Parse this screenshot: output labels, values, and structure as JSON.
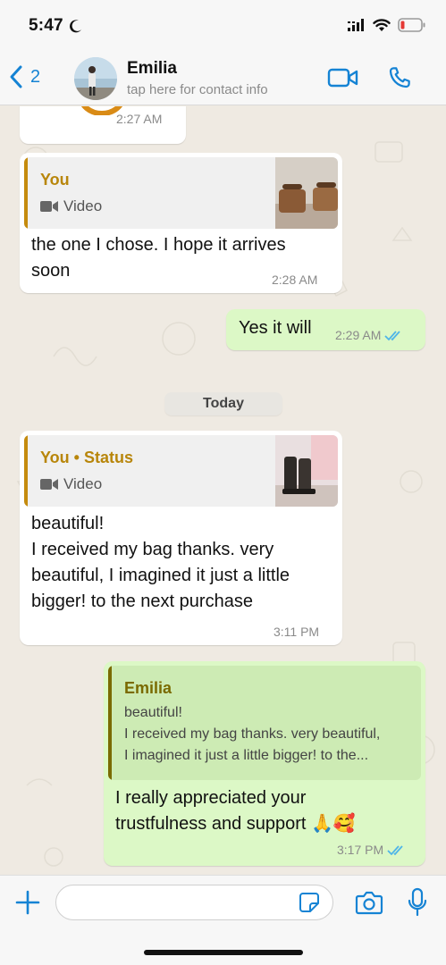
{
  "status_bar": {
    "time": "5:47"
  },
  "header": {
    "back_count": "2",
    "contact_name": "Emilia",
    "contact_subtitle": "tap here for contact info"
  },
  "messages": {
    "m0": {
      "time": "2:27 AM"
    },
    "m1": {
      "quote_author": "You",
      "quote_media": "Video",
      "line1": "the one I chose. I hope it arrives",
      "line2": "soon",
      "time": "2:28 AM"
    },
    "m2": {
      "text": "Yes it will",
      "time": "2:29 AM"
    },
    "date_separator": "Today",
    "m3": {
      "quote_author": "You • Status",
      "quote_media": "Video",
      "line1": "beautiful!",
      "line2": "I received my bag thanks. very",
      "line3": "beautiful, I imagined it just a little",
      "line4": "bigger! to the next purchase",
      "time": "3:11 PM"
    },
    "m4": {
      "quote_author": "Emilia",
      "quote_line1": "beautiful!",
      "quote_line2": "I received my bag thanks. very beautiful,",
      "quote_line3": "I imagined it just a little bigger! to the...",
      "line1": "I really appreciated your",
      "line2": "trustfulness and support 🙏🥰",
      "time": "3:17 PM"
    }
  },
  "colors": {
    "accent_blue": "#1583d4",
    "outgoing_bubble": "#dcf8c6",
    "incoming_bubble": "#ffffff",
    "quote_you": "#b8860b",
    "quote_emilia": "#7a6a00",
    "read_ticks": "#4fb5e8",
    "chat_background": "#efeae2"
  },
  "icons": [
    "moon-icon",
    "signal-icon",
    "wifi-icon",
    "battery-low-icon",
    "chevron-left-icon",
    "video-call-icon",
    "phone-icon",
    "video-icon",
    "double-check-icon",
    "plus-icon",
    "sticker-icon",
    "camera-icon",
    "microphone-icon"
  ]
}
